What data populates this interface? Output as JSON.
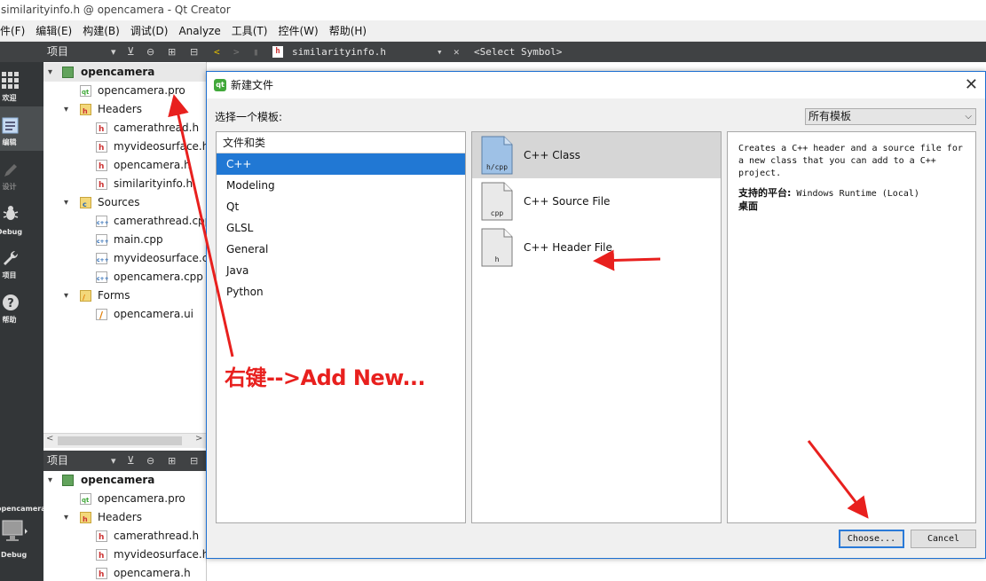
{
  "window": {
    "title": "similarityinfo.h @ opencamera - Qt Creator"
  },
  "menu": [
    "件(F)",
    "编辑(E)",
    "构建(B)",
    "调试(D)",
    "Analyze",
    "工具(T)",
    "控件(W)",
    "帮助(H)"
  ],
  "modes": [
    {
      "label": "欢迎",
      "icon": "grid-icon"
    },
    {
      "label": "编辑",
      "icon": "edit-icon",
      "active": true
    },
    {
      "label": "设计",
      "icon": "pen-icon"
    },
    {
      "label": "Debug",
      "icon": "bug-icon"
    },
    {
      "label": "项目",
      "icon": "wrench-icon"
    },
    {
      "label": "帮助",
      "icon": "help-icon"
    }
  ],
  "mini": {
    "project": "opencamera",
    "label": "Debug"
  },
  "panel": {
    "label": "项目"
  },
  "editor": {
    "file": "similarityinfo.h",
    "symbol": "<Select Symbol>"
  },
  "tree": {
    "project": "opencamera",
    "pro": "opencamera.pro",
    "headers_label": "Headers",
    "headers": [
      "camerathread.h",
      "myvideosurface.h",
      "opencamera.h",
      "similarityinfo.h"
    ],
    "sources_label": "Sources",
    "sources": [
      "camerathread.cpp",
      "main.cpp",
      "myvideosurface.cpp",
      "opencamera.cpp"
    ],
    "forms_label": "Forms",
    "forms": [
      "opencamera.ui"
    ]
  },
  "tree2": {
    "project": "opencamera",
    "pro": "opencamera.pro",
    "headers_label": "Headers",
    "headers": [
      "camerathread.h",
      "myvideosurface.h",
      "opencamera.h"
    ]
  },
  "dialog": {
    "title": "新建文件",
    "template_label": "选择一个模板:",
    "filter": "所有模板",
    "category_header": "文件和类",
    "categories": [
      "C++",
      "Modeling",
      "Qt",
      "GLSL",
      "General",
      "Java",
      "Python"
    ],
    "items": [
      {
        "label": "C++ Class",
        "badge": "h/cpp"
      },
      {
        "label": "C++ Source File",
        "badge": "cpp"
      },
      {
        "label": "C++ Header File",
        "badge": "h"
      }
    ],
    "description": "Creates a C++ header and a source file for a new class that you can add to a C++ project.",
    "platforms_label": "支持的平台:",
    "platforms_value": " Windows Runtime (Local)",
    "platforms_extra": "桌面",
    "choose": "Choose...",
    "cancel": "Cancel"
  },
  "annotation": {
    "text": "右键-->Add New..."
  },
  "colors": {
    "annotation": "#e8201e",
    "selection": "#2178d4",
    "sidebar": "#333638",
    "toolbar": "#404244"
  }
}
